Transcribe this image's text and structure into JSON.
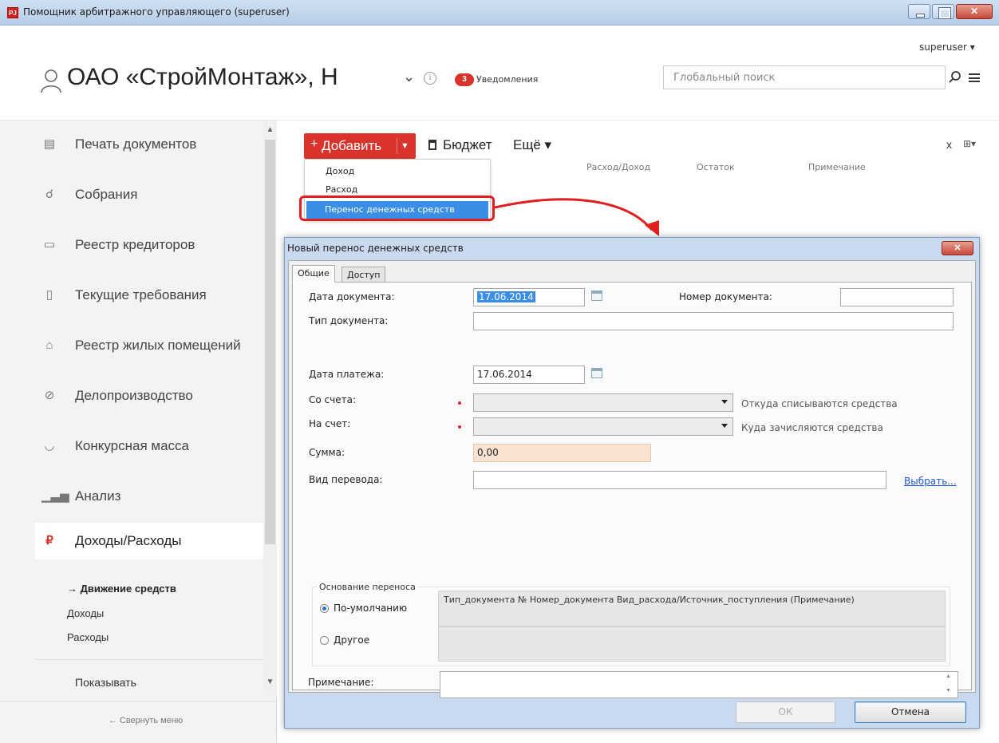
{
  "window": {
    "title": "Помощник арбитражного управляющего (superuser)",
    "logo_text": "PJ"
  },
  "header": {
    "user_menu": "superuser ▾",
    "org_title": "ОАО «СтройМонтаж», Н",
    "notifications_count": "3",
    "notifications_label": "Уведомления",
    "search_placeholder": "Глобальный поиск"
  },
  "sidebar": {
    "items": [
      {
        "label": "Печать документов",
        "icon": "print-docs-icon"
      },
      {
        "label": "Собрания",
        "icon": "meetings-icon"
      },
      {
        "label": "Реестр кредиторов",
        "icon": "creditors-registry-icon"
      },
      {
        "label": "Текущие требования",
        "icon": "current-claims-icon"
      },
      {
        "label": "Реестр жилых помещений",
        "icon": "housing-registry-icon"
      },
      {
        "label": "Делопроизводство",
        "icon": "paperclip-icon"
      },
      {
        "label": "Конкурсная масса",
        "icon": "estate-icon"
      },
      {
        "label": "Анализ",
        "icon": "bar-chart-icon"
      },
      {
        "label": "Доходы/Расходы",
        "icon": "income-expense-icon"
      }
    ],
    "sub_items": [
      "→ Движение средств",
      "Доходы",
      "Расходы"
    ],
    "show_label": "Показывать",
    "collapse_label": "←  Свернуть меню"
  },
  "toolbar": {
    "add_label": "Добавить",
    "budget_label": "Бюджет",
    "more_label": "Ещё ▾",
    "close_label": "x",
    "columns": [
      "Расход/Доход",
      "Остаток",
      "Примечание"
    ]
  },
  "add_menu": {
    "items": [
      "Доход",
      "Расход",
      "Перенос денежных средств"
    ]
  },
  "dialog": {
    "title": "Новый перенос денежных средств",
    "tabs": [
      "Общие",
      "Доступ"
    ],
    "fields": {
      "doc_date_label": "Дата документа:",
      "doc_date_value": "17.06.2014",
      "doc_number_label": "Номер документа:",
      "doc_number_value": "",
      "doc_type_label": "Тип документа:",
      "doc_type_value": "",
      "payment_date_label": "Дата платежа:",
      "payment_date_value": "17.06.2014",
      "from_account_label": "Со счета:",
      "from_account_hint": "Откуда списываются средства",
      "to_account_label": "На счет:",
      "to_account_hint": "Куда зачисляются средства",
      "sum_label": "Сумма:",
      "sum_value": "0,00",
      "transfer_type_label": "Вид перевода:",
      "transfer_type_value": "",
      "choose_link": "Выбрать..."
    },
    "basis": {
      "legend": "Основание переноса",
      "default_label": "По-умолчанию",
      "default_text": "Тип_документа № Номер_документа Вид_расхода/Источник_поступления (Примечание)",
      "other_label": "Другое",
      "selected": "default"
    },
    "note_label": "Примечание:",
    "note_value": "",
    "ok_label": "ОК",
    "cancel_label": "Отмена"
  },
  "colors": {
    "accent_red": "#d9332c",
    "menu_highlight": "#3a8ee6",
    "sum_field_bg": "#fbe3d2",
    "dialog_frame": "#c9daf0"
  }
}
